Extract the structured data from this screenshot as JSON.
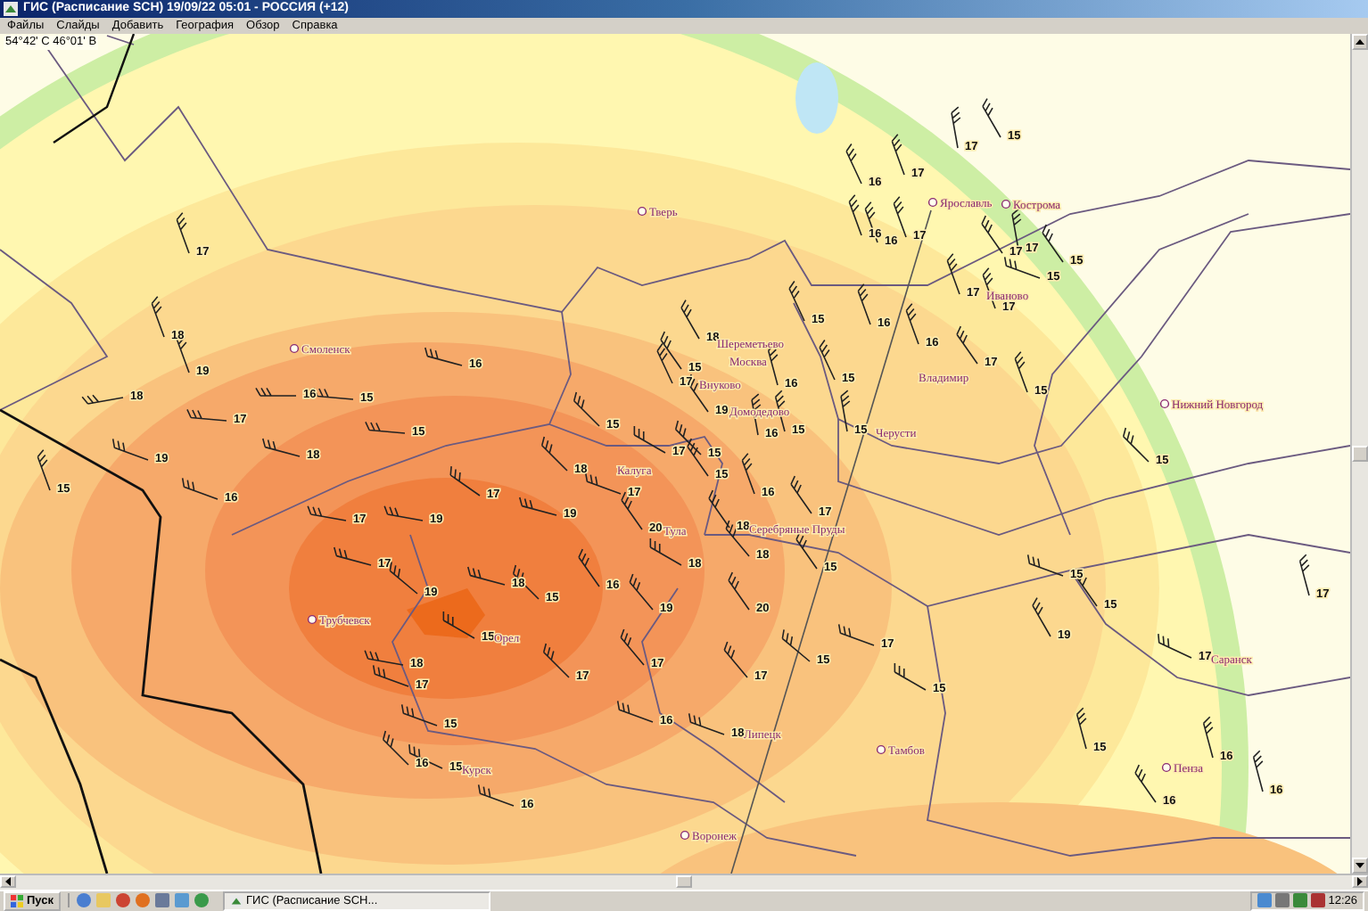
{
  "window": {
    "title": "ГИС (Расписание SCH) 19/09/22 05:01 - РОССИЯ (+12)"
  },
  "menu": [
    "Файлы",
    "Слайды",
    "Добавить",
    "География",
    "Обзор",
    "Справка"
  ],
  "coordinates": "54°42' С 46°01' В",
  "map": {
    "cities": [
      {
        "name": "Ярославль",
        "kind": "city"
      },
      {
        "name": "Кострома",
        "kind": "city"
      },
      {
        "name": "Тверь",
        "kind": "city"
      },
      {
        "name": "Иваново",
        "kind": "station"
      },
      {
        "name": "Шереметьево",
        "kind": "station"
      },
      {
        "name": "Смоленск",
        "kind": "city"
      },
      {
        "name": "Москва",
        "kind": "station"
      },
      {
        "name": "Владимир",
        "kind": "station"
      },
      {
        "name": "Внуково",
        "kind": "station"
      },
      {
        "name": "Нижний Новгород",
        "kind": "city"
      },
      {
        "name": "Домодедово",
        "kind": "station"
      },
      {
        "name": "Черусти",
        "kind": "station"
      },
      {
        "name": "Калуга",
        "kind": "station"
      },
      {
        "name": "Тула",
        "kind": "station"
      },
      {
        "name": "Серебряные Пруды",
        "kind": "station"
      },
      {
        "name": "Трубчевск",
        "kind": "city"
      },
      {
        "name": "Орел",
        "kind": "station"
      },
      {
        "name": "Саранск",
        "kind": "station"
      },
      {
        "name": "Липецк",
        "kind": "station"
      },
      {
        "name": "Тамбов",
        "kind": "city"
      },
      {
        "name": "Курск",
        "kind": "station"
      },
      {
        "name": "Пенза",
        "kind": "city"
      },
      {
        "name": "Воронеж",
        "kind": "city"
      }
    ],
    "wind_speeds": [
      "15",
      "17",
      "17",
      "16",
      "17",
      "16",
      "16",
      "17",
      "17",
      "17",
      "15",
      "15",
      "18",
      "19",
      "15",
      "18",
      "16",
      "16",
      "17",
      "17",
      "15",
      "16",
      "18",
      "16",
      "15",
      "16",
      "15",
      "17",
      "15",
      "17",
      "17",
      "15",
      "15",
      "19",
      "16",
      "15",
      "15",
      "19",
      "15",
      "18",
      "17",
      "15",
      "15",
      "18",
      "15",
      "16",
      "17",
      "17",
      "16",
      "17",
      "19",
      "19",
      "20",
      "18",
      "17",
      "17",
      "18",
      "18",
      "15",
      "18",
      "15",
      "16",
      "15",
      "19",
      "15",
      "19",
      "20",
      "19",
      "15",
      "18",
      "17",
      "17",
      "17",
      "17",
      "17",
      "17",
      "17",
      "15",
      "15",
      "15",
      "16",
      "18",
      "15",
      "16",
      "16",
      "15",
      "16",
      "16",
      "16"
    ]
  },
  "taskbar": {
    "start": "Пуск",
    "tasks": [
      {
        "label": "ГИС (Расписание SCH...",
        "selected": true
      }
    ],
    "clock": "12:26"
  }
}
